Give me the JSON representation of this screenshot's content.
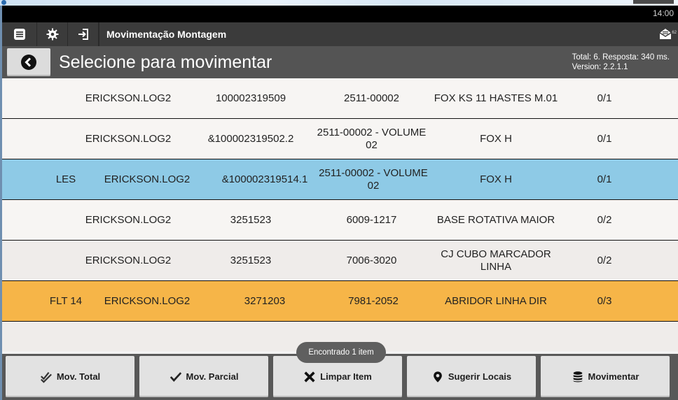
{
  "status_bar": {
    "time": "14:00"
  },
  "action_bar": {
    "title": "Movimentação Montagem",
    "mail_badge": "62",
    "icons": [
      "list-icon",
      "gear-icon",
      "sign-in-icon",
      "envelope-icon"
    ]
  },
  "header": {
    "title": "Selecione para movimentar",
    "info_line1": "Total: 6. Resposta: 340 ms.",
    "info_line2": "Version: 2.2.1.1"
  },
  "rows": [
    {
      "tag": "",
      "user": "ERICKSON.LOG2",
      "code": "100002319509",
      "ref": "2511-00002",
      "desc": "FOX KS 11 HASTES M.01",
      "qty": "0/1",
      "color": "#f7f5f3"
    },
    {
      "tag": "",
      "user": "ERICKSON.LOG2",
      "code": "&100002319502.2",
      "ref": "2511-00002 - VOLUME 02",
      "desc": "FOX H",
      "qty": "0/1",
      "color": "#f7f5f3"
    },
    {
      "tag": "LES",
      "user": "ERICKSON.LOG2",
      "code": "&100002319514.1",
      "ref": "2511-00002 - VOLUME 02",
      "desc": "FOX H",
      "qty": "0/1",
      "color": "#8ecae6"
    },
    {
      "tag": "",
      "user": "ERICKSON.LOG2",
      "code": "3251523",
      "ref": "6009-1217",
      "desc": "BASE ROTATIVA MAIOR",
      "qty": "0/2",
      "color": "#f7f5f3"
    },
    {
      "tag": "",
      "user": "ERICKSON.LOG2",
      "code": "3251523",
      "ref": "7006-3020",
      "desc": "CJ CUBO MARCADOR LINHA",
      "qty": "0/2",
      "color": "#efecea"
    },
    {
      "tag": "FLT 14",
      "user": "ERICKSON.LOG2",
      "code": "3271203",
      "ref": "7981-2052",
      "desc": "ABRIDOR LINHA DIR",
      "qty": "0/3",
      "color": "#f6b548"
    }
  ],
  "toast": "Encontrado 1 item",
  "buttons": {
    "mov_total": "Mov. Total",
    "mov_parcial": "Mov. Parcial",
    "limpar_item": "Limpar Item",
    "sugerir_locais": "Sugerir Locais",
    "movimentar": "Movimentar"
  }
}
